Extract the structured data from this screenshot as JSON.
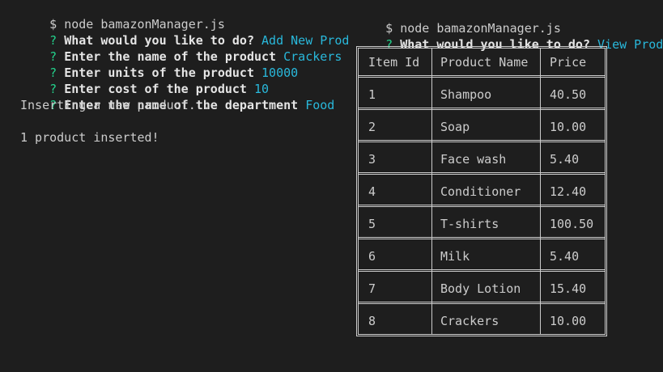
{
  "left_terminal": {
    "command_prompt": "$",
    "command": "node bamazonManager.js",
    "qa": [
      {
        "mark": "?",
        "question": "What would you like to do?",
        "answer": "Add New Product"
      },
      {
        "mark": "?",
        "question": "Enter the name of the product",
        "answer": "Crackers"
      },
      {
        "mark": "?",
        "question": "Enter units of the product",
        "answer": "10000"
      },
      {
        "mark": "?",
        "question": "Enter cost of the product",
        "answer": "10"
      },
      {
        "mark": "?",
        "question": "Enter the name of the department",
        "answer": "Food"
      }
    ],
    "output_1": "Inserting a new product...",
    "output_2": "1 product inserted!"
  },
  "right_terminal": {
    "command_prompt": "$",
    "command": "node bamazonManager.js",
    "qa": [
      {
        "mark": "?",
        "question": "What would you like to do?",
        "answer": "View Products"
      }
    ],
    "table": {
      "headers": [
        "Item Id",
        "Product Name",
        "Price"
      ],
      "rows": [
        [
          "1",
          "Shampoo",
          "40.50"
        ],
        [
          "2",
          "Soap",
          "10.00"
        ],
        [
          "3",
          "Face wash",
          "5.40"
        ],
        [
          "4",
          "Conditioner",
          "12.40"
        ],
        [
          "5",
          "T-shirts",
          "100.50"
        ],
        [
          "6",
          "Milk",
          "5.40"
        ],
        [
          "7",
          "Body Lotion",
          "15.40"
        ],
        [
          "8",
          "Crackers",
          "10.00"
        ]
      ]
    }
  }
}
